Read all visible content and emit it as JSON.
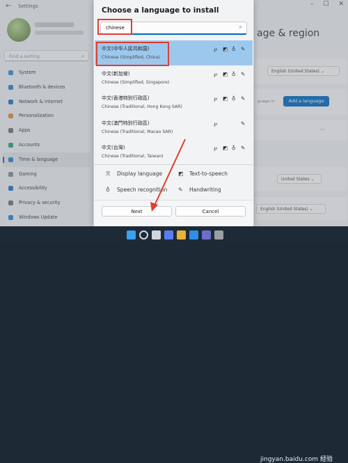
{
  "window": {
    "title": "Settings",
    "controls": [
      "–",
      "☐",
      "✕"
    ]
  },
  "sidebar": {
    "search_placeholder": "Find a setting",
    "items": [
      {
        "label": "System",
        "icon_color": "#3b86d6"
      },
      {
        "label": "Bluetooth & devices",
        "icon_color": "#2f7fd0"
      },
      {
        "label": "Network & internet",
        "icon_color": "#2b6fb8"
      },
      {
        "label": "Personalization",
        "icon_color": "#e08a40"
      },
      {
        "label": "Apps",
        "icon_color": "#6d6f72"
      },
      {
        "label": "Accounts",
        "icon_color": "#2aa37a"
      },
      {
        "label": "Time & language",
        "icon_color": "#2a7fd4"
      },
      {
        "label": "Gaming",
        "icon_color": "#888b8e"
      },
      {
        "label": "Accessibility",
        "icon_color": "#2a6fc0"
      },
      {
        "label": "Privacy & security",
        "icon_color": "#6f7478"
      },
      {
        "label": "Windows Update",
        "icon_color": "#2a7fd4"
      }
    ],
    "active_index": 6
  },
  "main": {
    "heading": "age & region",
    "display_language_value": "English (United States)",
    "add_language_hint": "guage in",
    "add_language_button": "Add a language",
    "more_dots": "···",
    "country_value": "United States",
    "format_value": "English (United States)"
  },
  "dialog": {
    "title": "Choose a language to install",
    "search_value": "chinese",
    "languages": [
      {
        "native": "中文(中华人民共和国)",
        "english": "Chinese (Simplified, China)",
        "features": [
          "display",
          "tts",
          "speech",
          "handwriting"
        ],
        "selected": true
      },
      {
        "native": "中文(新加坡)",
        "english": "Chinese (Simplified, Singapore)",
        "features": [
          "display",
          "tts",
          "speech",
          "handwriting"
        ],
        "selected": false
      },
      {
        "native": "中文(香港特別行政區)",
        "english": "Chinese (Traditional, Hong Kong SAR)",
        "features": [
          "display",
          "tts",
          "speech",
          "handwriting"
        ],
        "selected": false
      },
      {
        "native": "中文(澳門特別行政區)",
        "english": "Chinese (Traditional, Macao SAR)",
        "features": [
          "display",
          "handwriting"
        ],
        "selected": false
      },
      {
        "native": "中文(台灣)",
        "english": "Chinese (Traditional, Taiwan)",
        "features": [
          "display",
          "tts",
          "speech",
          "handwriting"
        ],
        "selected": false
      }
    ],
    "feature_legend": {
      "display": "Display language",
      "tts": "Text-to-speech",
      "speech": "Speech recognition",
      "handwriting": "Handwriting"
    },
    "next_button": "Next",
    "cancel_button": "Cancel"
  },
  "watermark": {
    "text": "jingyan.baidu.com",
    "label": "经验"
  },
  "colors": {
    "accent": "#0067c0",
    "selected_row": "#9dc8ee",
    "annotation_red": "#e03c31"
  }
}
